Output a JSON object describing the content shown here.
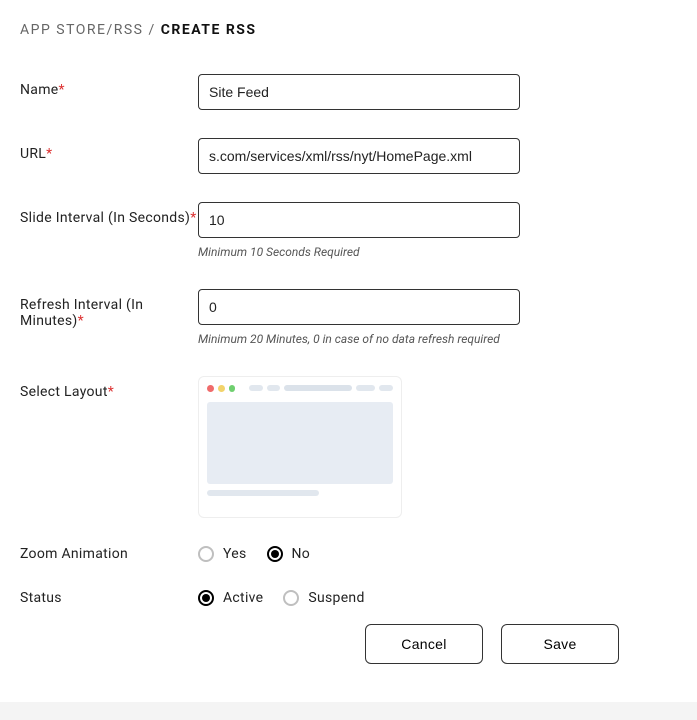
{
  "breadcrumb": {
    "parent": "APP STORE/RSS",
    "sep": " / ",
    "current": "CREATE RSS"
  },
  "fields": {
    "name": {
      "label": "Name",
      "value": "Site Feed"
    },
    "url": {
      "label": "URL",
      "value": "s.com/services/xml/rss/nyt/HomePage.xml"
    },
    "slide_interval": {
      "label": "Slide Interval (In Seconds)",
      "value": "10",
      "hint": "Minimum 10 Seconds Required"
    },
    "refresh_interval": {
      "label": "Refresh Interval (In Minutes)",
      "value": "0",
      "hint": "Minimum 20 Minutes, 0 in case of no data refresh required"
    },
    "select_layout": {
      "label": "Select Layout"
    },
    "zoom_animation": {
      "label": "Zoom Animation",
      "options": {
        "yes": "Yes",
        "no": "No"
      },
      "selected": "no"
    },
    "status": {
      "label": "Status",
      "options": {
        "active": "Active",
        "suspend": "Suspend"
      },
      "selected": "active"
    }
  },
  "actions": {
    "cancel": "Cancel",
    "save": "Save"
  }
}
